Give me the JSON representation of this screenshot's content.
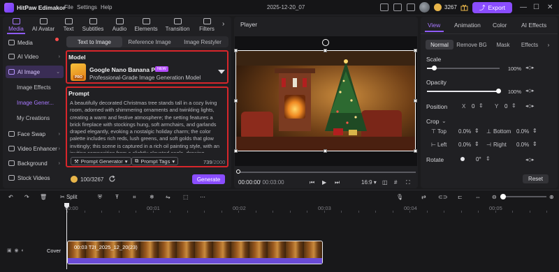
{
  "app": {
    "name": "HitPaw Edimakor",
    "menu": [
      "File",
      "Settings",
      "Help"
    ],
    "doc_title": "2025-12-20_07",
    "credits": "3267",
    "export_label": "Export",
    "accent": "#8a4dff"
  },
  "categories": [
    {
      "label": "Media",
      "icon": "media-icon"
    },
    {
      "label": "AI Avatar",
      "icon": "avatar-icon"
    },
    {
      "label": "Text",
      "icon": "text-icon"
    },
    {
      "label": "Subtitles",
      "icon": "subtitles-icon"
    },
    {
      "label": "Audio",
      "icon": "audio-icon"
    },
    {
      "label": "Elements",
      "icon": "elements-icon"
    },
    {
      "label": "Transition",
      "icon": "transition-icon"
    },
    {
      "label": "Filters",
      "icon": "filters-icon"
    }
  ],
  "sidebar": {
    "items": [
      {
        "label": "Media"
      },
      {
        "label": "AI Video"
      },
      {
        "label": "AI Image"
      },
      {
        "label": "Face Swap"
      },
      {
        "label": "Video Enhancer"
      },
      {
        "label": "Background"
      },
      {
        "label": "Stock Videos"
      }
    ],
    "sub_items": [
      "Image Effects",
      "Image Gener...",
      "My Creations"
    ]
  },
  "image_tabs": [
    "Text to Image",
    "Reference Image",
    "Image Restyler"
  ],
  "model": {
    "section_label": "Model",
    "name": "Google Nano Banana Pro",
    "badge": "NEW",
    "description": "Professional-Grade Image Generation Model",
    "thumb_label": "PRO"
  },
  "prompt": {
    "section_label": "Prompt",
    "text": "A beautifully decorated Christmas tree stands tall in a cozy living room, adorned with shimmering ornaments and twinkling lights, creating a warm and festive atmosphere; the setting features a brick fireplace with stockings hung, soft armchairs, and garlands draped elegantly, evoking a nostalgic holiday charm; the color palette includes rich reds, lush greens, and soft golds that glow invitingly; this scene is captured in a rich oil painting style, with an inviting composition from a slightly elevated angle, drawing",
    "generator_label": "Prompt Generator",
    "tags_label": "Prompt Tags",
    "char_count": "739",
    "char_max": "/2000"
  },
  "generate": {
    "credit_text": "100/3267",
    "button_label": "Generate"
  },
  "player": {
    "title": "Player",
    "time_current": "00:00:00",
    "time_total": "/ 00:03:00",
    "aspect": "16:9"
  },
  "right_panel": {
    "tabs": [
      "View",
      "Animation",
      "Color",
      "AI Effects"
    ],
    "modes": [
      "Normal",
      "Remove BG",
      "Mask",
      "Effects"
    ],
    "scale_label": "Scale",
    "scale_value": "100%",
    "scale_level": 0.1,
    "opacity_label": "Opacity",
    "opacity_value": "100%",
    "opacity_level": 1.0,
    "position_label": "Position",
    "pos_x_label": "X",
    "pos_x": "0",
    "pos_y_label": "Y",
    "pos_y": "0",
    "crop_label": "Crop",
    "crop_top_label": "Top",
    "crop_top": "0.0%",
    "crop_bottom_label": "Bottom",
    "crop_bottom": "0.0%",
    "crop_left_label": "Left",
    "crop_left": "0.0%",
    "crop_right_label": "Right",
    "crop_right": "0.0%",
    "rotate_label": "Rotate",
    "rotate_value": "0",
    "rotate_unit": "°",
    "reset_label": "Reset"
  },
  "timeline": {
    "split_label": "Split",
    "ruler": [
      "00:00",
      "00:01",
      "00:02",
      "00:03",
      "00:04",
      "00:05"
    ],
    "cover_label": "Cover",
    "clip_label": "00:03  T2I_2025_12_20(23)"
  }
}
